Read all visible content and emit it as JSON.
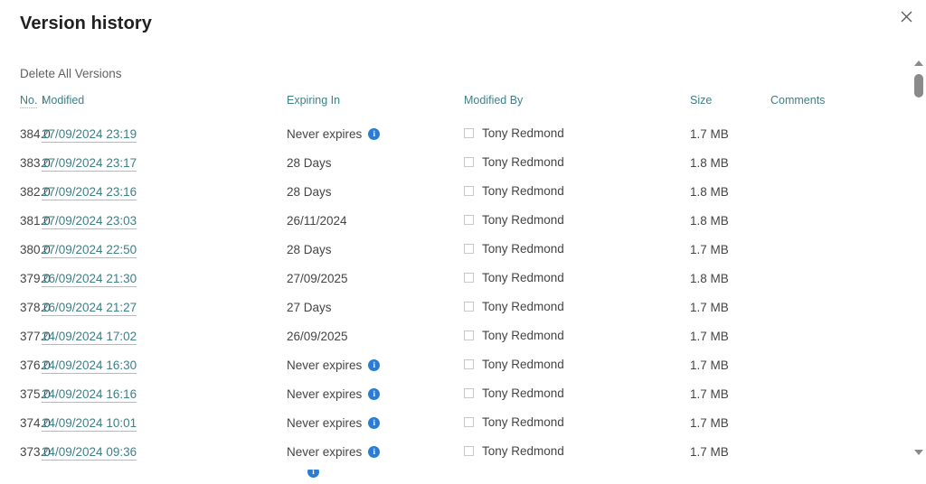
{
  "dialog": {
    "title": "Version history",
    "close_icon": "close-icon"
  },
  "command_bar": {
    "delete_all_label": "Delete All Versions"
  },
  "table": {
    "columns": [
      {
        "key": "no",
        "label": "No.",
        "sortable": true,
        "sort_direction": "descending",
        "sort_arrow": "↓"
      },
      {
        "key": "modified",
        "label": "Modified",
        "sortable": false
      },
      {
        "key": "expiring_in",
        "label": "Expiring In",
        "sortable": false
      },
      {
        "key": "modified_by",
        "label": "Modified By",
        "sortable": false
      },
      {
        "key": "size",
        "label": "Size",
        "sortable": false
      },
      {
        "key": "comments",
        "label": "Comments",
        "sortable": false
      }
    ],
    "info_icon_glyph": "i",
    "rows": [
      {
        "no": "384.0",
        "modified": "27/09/2024 23:19",
        "expiring_in": "Never expires",
        "has_info_icon": true,
        "modified_by": "Tony Redmond",
        "size": "1.7 MB",
        "comments": ""
      },
      {
        "no": "383.0",
        "modified": "27/09/2024 23:17",
        "expiring_in": "28 Days",
        "has_info_icon": false,
        "modified_by": "Tony Redmond",
        "size": "1.8 MB",
        "comments": ""
      },
      {
        "no": "382.0",
        "modified": "27/09/2024 23:16",
        "expiring_in": "28 Days",
        "has_info_icon": false,
        "modified_by": "Tony Redmond",
        "size": "1.8 MB",
        "comments": ""
      },
      {
        "no": "381.0",
        "modified": "27/09/2024 23:03",
        "expiring_in": "26/11/2024",
        "has_info_icon": false,
        "modified_by": "Tony Redmond",
        "size": "1.8 MB",
        "comments": ""
      },
      {
        "no": "380.0",
        "modified": "27/09/2024 22:50",
        "expiring_in": "28 Days",
        "has_info_icon": false,
        "modified_by": "Tony Redmond",
        "size": "1.7 MB",
        "comments": ""
      },
      {
        "no": "379.0",
        "modified": "26/09/2024 21:30",
        "expiring_in": "27/09/2025",
        "has_info_icon": false,
        "modified_by": "Tony Redmond",
        "size": "1.8 MB",
        "comments": ""
      },
      {
        "no": "378.0",
        "modified": "26/09/2024 21:27",
        "expiring_in": "27 Days",
        "has_info_icon": false,
        "modified_by": "Tony Redmond",
        "size": "1.7 MB",
        "comments": ""
      },
      {
        "no": "377.0",
        "modified": "24/09/2024 17:02",
        "expiring_in": "26/09/2025",
        "has_info_icon": false,
        "modified_by": "Tony Redmond",
        "size": "1.7 MB",
        "comments": ""
      },
      {
        "no": "376.0",
        "modified": "24/09/2024 16:30",
        "expiring_in": "Never expires",
        "has_info_icon": true,
        "modified_by": "Tony Redmond",
        "size": "1.7 MB",
        "comments": ""
      },
      {
        "no": "375.0",
        "modified": "24/09/2024 16:16",
        "expiring_in": "Never expires",
        "has_info_icon": true,
        "modified_by": "Tony Redmond",
        "size": "1.7 MB",
        "comments": ""
      },
      {
        "no": "374.0",
        "modified": "24/09/2024 10:01",
        "expiring_in": "Never expires",
        "has_info_icon": true,
        "modified_by": "Tony Redmond",
        "size": "1.7 MB",
        "comments": ""
      },
      {
        "no": "373.0",
        "modified": "24/09/2024 09:36",
        "expiring_in": "Never expires",
        "has_info_icon": true,
        "modified_by": "Tony Redmond",
        "size": "1.7 MB",
        "comments": ""
      }
    ],
    "clipped_row": {
      "expiring_in": "",
      "has_info_icon": true
    }
  },
  "scrollbar": {
    "up_arrow_icon": "scroll-up-arrow-icon",
    "down_arrow_icon": "scroll-down-arrow-icon"
  },
  "colors": {
    "link": "#3f7f88",
    "header": "#3f7f88",
    "info_icon": "#2b7cd3",
    "title": "#212121",
    "text": "#444444"
  }
}
